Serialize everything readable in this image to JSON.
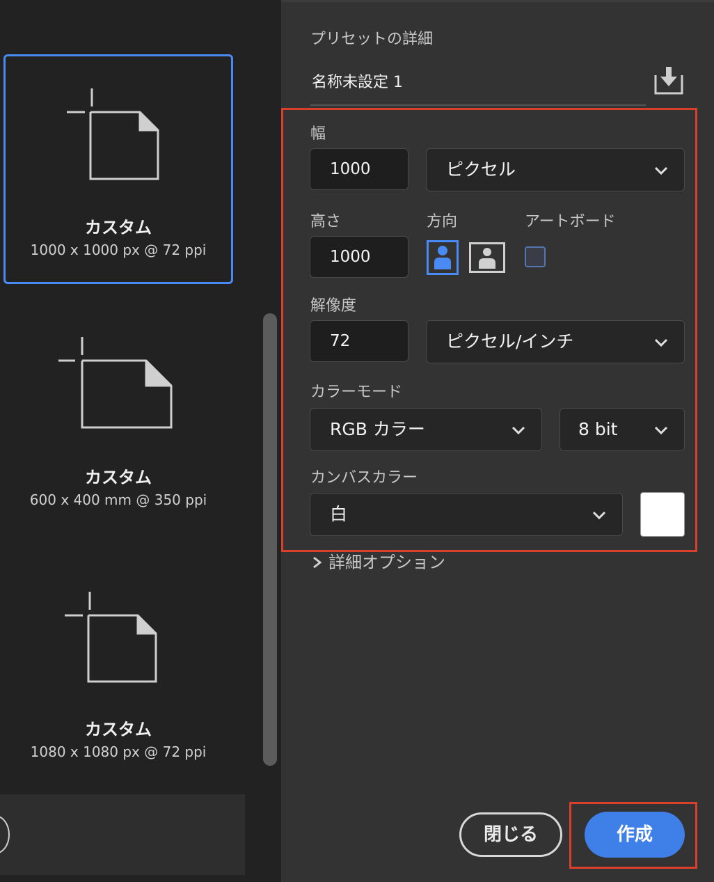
{
  "presets": [
    {
      "name": "カスタム",
      "size": "1000 x 1000 px @ 72 ppi",
      "selected": true
    },
    {
      "name": "カスタム",
      "size": "600 x 400 mm @ 350 ppi",
      "selected": false
    },
    {
      "name": "カスタム",
      "size": "1080 x 1080 px @ 72 ppi",
      "selected": false
    }
  ],
  "details": {
    "section_title": "プリセットの詳細",
    "doc_name": "名称未設定 1",
    "width_label": "幅",
    "width_value": "1000",
    "width_unit": "ピクセル",
    "height_label": "高さ",
    "height_value": "1000",
    "orientation_label": "方向",
    "artboard_label": "アートボード",
    "resolution_label": "解像度",
    "resolution_value": "72",
    "resolution_unit": "ピクセル/インチ",
    "color_mode_label": "カラーモード",
    "color_mode_value": "RGB カラー",
    "bit_depth_value": "8 bit",
    "canvas_color_label": "カンバスカラー",
    "canvas_color_value": "白",
    "canvas_swatch_color": "#ffffff",
    "advanced_options": "詳細オプション"
  },
  "buttons": {
    "close": "閉じる",
    "create": "作成"
  },
  "icons": {
    "save_preset": "download-tray-icon",
    "portrait": "portrait-person-icon",
    "landscape": "landscape-person-icon",
    "dropdown": "chevron-down-icon",
    "expand": "chevron-right-icon",
    "new_doc": "new-document-icon"
  },
  "colors": {
    "accent": "#4a8af4",
    "primary_button": "#3f7fe8",
    "highlight_frame": "#d9402b"
  }
}
